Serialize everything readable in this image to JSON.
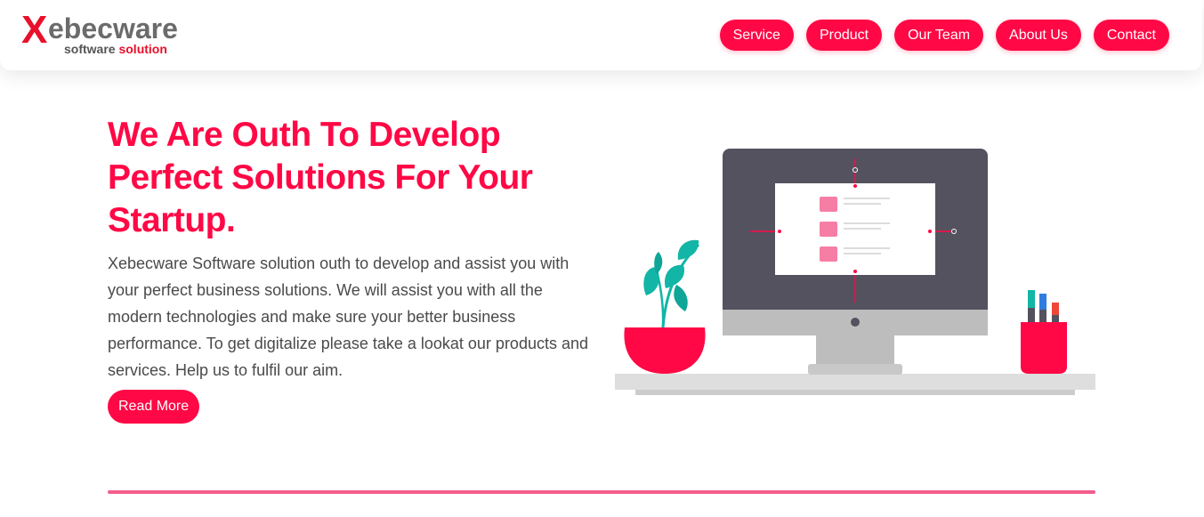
{
  "logo": {
    "mark": "X",
    "name_rest": "ebecware",
    "tagline_prefix": "software",
    "tagline_accent": "solution"
  },
  "nav": {
    "items": [
      "Service",
      "Product",
      "Our Team",
      "About Us",
      "Contact"
    ]
  },
  "hero": {
    "title": "We Are Outh To Develop Perfect Solutions For Your Startup.",
    "description": "Xebecware Software solution outh to develop and assist you with your perfect business solutions. We will assist you with all the modern technologies and make sure your better business performance. To get digitalize please take a lookat our products and services. Help us to fulfil our aim.",
    "cta_label": "Read More"
  },
  "illustration": {
    "icon": "desk-computer-illustration",
    "colors": {
      "accent": "#ff0845",
      "screen": "#55525f",
      "stand": "#bdbdbd",
      "desk": "#dedede",
      "leaf": "#12b5a6"
    }
  }
}
